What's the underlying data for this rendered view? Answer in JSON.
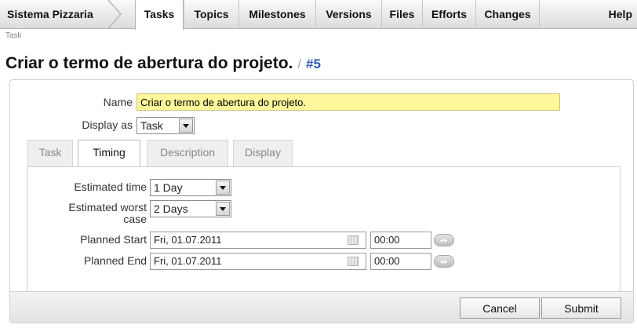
{
  "nav": {
    "project": "Sistema Pizzaria",
    "tabs": [
      "Tasks",
      "Topics",
      "Milestones",
      "Versions",
      "Files",
      "Efforts",
      "Changes"
    ],
    "active_tab": "Tasks",
    "help": "Help"
  },
  "breadcrumb": "Task",
  "heading": {
    "title": "Criar o termo de abertura do projeto.",
    "separator": "/",
    "number": "#5"
  },
  "form": {
    "name_label": "Name",
    "name_value": "Criar o termo de abertura do projeto.",
    "display_as_label": "Display as",
    "display_as_value": "Task",
    "tabs": [
      "Task",
      "Timing",
      "Description",
      "Display"
    ],
    "active_tab": "Timing",
    "timing": {
      "estimated_time_label": "Estimated time",
      "estimated_time_value": "1 Day",
      "estimated_worst_label_1": "Estimated worst",
      "estimated_worst_label_2": "case",
      "estimated_worst_value": "2 Days",
      "planned_start_label": "Planned Start",
      "planned_start_date": "Fri, 01.07.2011",
      "planned_start_time": "00:00",
      "planned_end_label": "Planned End",
      "planned_end_date": "Fri, 01.07.2011",
      "planned_end_time": "00:00"
    },
    "cancel_label": "Cancel",
    "submit_label": "Submit"
  },
  "icons": {
    "calendar": "calendar-icon",
    "stepper": "time-stepper-icon",
    "dropdown": "chevron-down-icon"
  },
  "colors": {
    "name_highlight": "#fff799",
    "title_number": "#2f5ab5"
  }
}
